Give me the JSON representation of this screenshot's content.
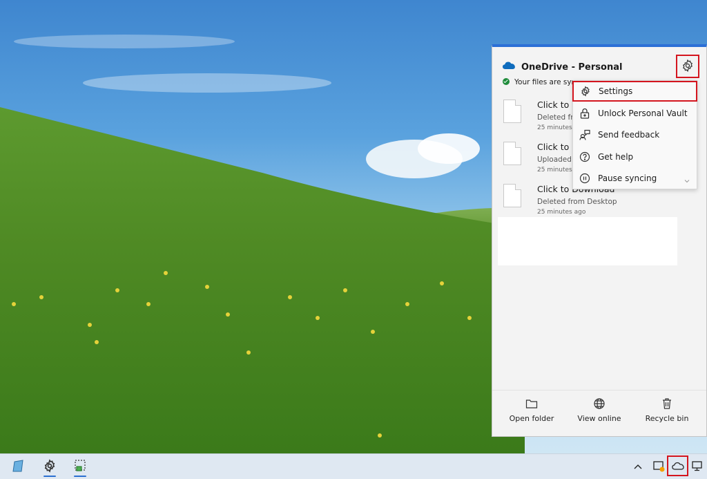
{
  "onedrive": {
    "title": "OneDrive - Personal",
    "status": "Your files are synced",
    "files": [
      {
        "name": "Click to Download",
        "action": "Deleted from Desktop",
        "time": "25 minutes ago"
      },
      {
        "name": "Click to Download",
        "action": "Uploaded to Desktop",
        "time": "25 minutes ago"
      },
      {
        "name": "Click to Download",
        "action": "Deleted from Desktop",
        "time": "25 minutes ago"
      }
    ],
    "footer": {
      "open_folder": "Open folder",
      "view_online": "View online",
      "recycle_bin": "Recycle bin"
    }
  },
  "menu": {
    "settings": "Settings",
    "vault": "Unlock Personal Vault",
    "feedback": "Send feedback",
    "help": "Get help",
    "pause": "Pause syncing"
  },
  "colors": {
    "accent": "#2b6fd6",
    "highlight": "#d4151e",
    "synced": "#1f8c3b"
  }
}
